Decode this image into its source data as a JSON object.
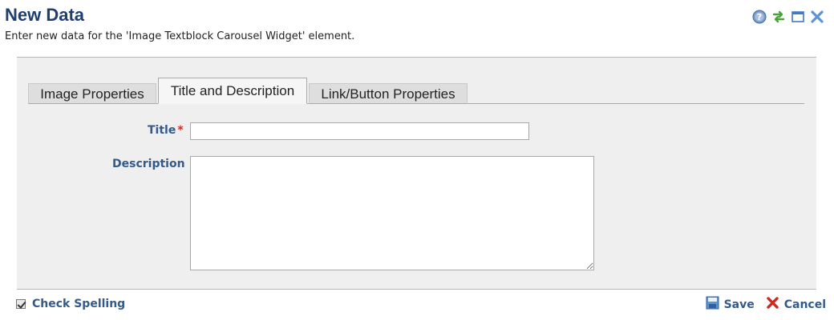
{
  "header": {
    "title": "New Data",
    "subtitle": "Enter new data for the 'Image Textblock Carousel Widget' element."
  },
  "window_icons": [
    "help-icon",
    "refresh-icon",
    "maximize-icon",
    "close-icon"
  ],
  "tabs": [
    {
      "label": "Image Properties",
      "active": false
    },
    {
      "label": "Title and Description",
      "active": true
    },
    {
      "label": "Link/Button Properties",
      "active": false
    }
  ],
  "form": {
    "title_label": "Title",
    "required_mark": "*",
    "title_value": "",
    "description_label": "Description",
    "description_value": ""
  },
  "footer": {
    "check_spelling_label": "Check Spelling",
    "check_spelling_checked": true,
    "save_label": "Save",
    "cancel_label": "Cancel"
  },
  "colors": {
    "heading": "#1f3f6e",
    "label": "#335a88",
    "required": "#d9261c",
    "panel_bg": "#efefef",
    "cancel_icon": "#d9261c",
    "save_icon": "#3a78c2"
  }
}
